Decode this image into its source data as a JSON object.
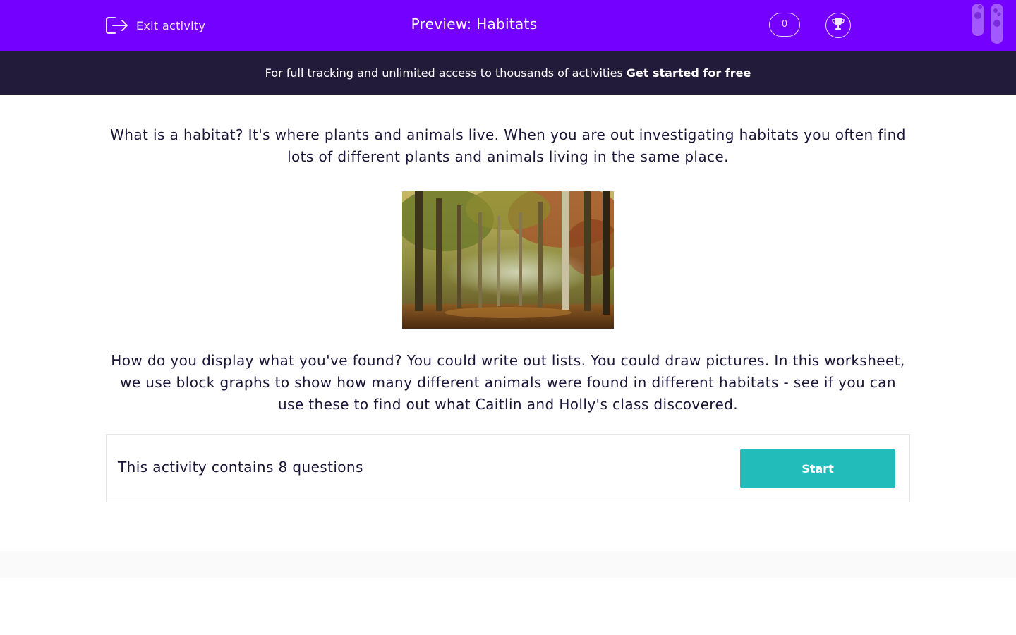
{
  "header": {
    "exit_label": "Exit activity",
    "title": "Preview: Habitats",
    "score": "0",
    "icons": [
      "exit-icon",
      "trophy-icon",
      "test-tubes-icon"
    ]
  },
  "banner": {
    "text": "For full tracking and unlimited access to thousands of activities",
    "cta": "Get started for free"
  },
  "content": {
    "intro": "What is a habitat? It's where plants and animals live. When you are out investigating habitats you often find lots of different plants and animals living in the same place.",
    "image": "forest-habitat-photo",
    "body": "How do you display what you've found? You could write out lists. You could draw pictures. In this worksheet, we use block graphs to show how many different animals were found in different habitats - see if you can use these to find out what Caitlin and Holly's class discovered."
  },
  "activity": {
    "summary": "This activity contains 8 questions",
    "start_label": "Start"
  },
  "colors": {
    "header_bg": "#7400ff",
    "banner_bg": "#231b3a",
    "button_bg": "#22bcbb",
    "text": "#1b1537"
  }
}
